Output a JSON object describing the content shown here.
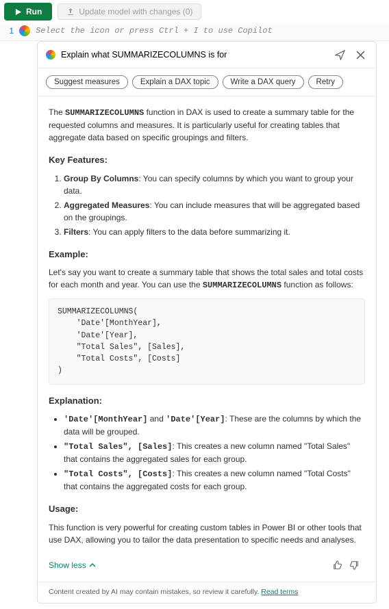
{
  "toolbar": {
    "run_label": "Run",
    "update_label": "Update model with changes (0)"
  },
  "editor": {
    "line": "1",
    "placeholder": "Select the icon or press Ctrl + I to use Copilot"
  },
  "panel": {
    "input_value": "Explain what SUMMARIZECOLUMNS is for",
    "chips": [
      "Suggest measures",
      "Explain a DAX topic",
      "Write a DAX query",
      "Retry"
    ]
  },
  "response": {
    "intro_pre": "The ",
    "intro_fn": "SUMMARIZECOLUMNS",
    "intro_post": " function in DAX is used to create a summary table for the requested columns and measures. It is particularly useful for creating tables that aggregate data based on specific groupings and filters.",
    "features_heading": "Key Features:",
    "features": [
      {
        "b": "Group By Columns",
        "t": ": You can specify columns by which you want to group your data."
      },
      {
        "b": "Aggregated Measures",
        "t": ": You can include measures that will be aggregated based on the groupings."
      },
      {
        "b": "Filters",
        "t": ": You can apply filters to the data before summarizing it."
      }
    ],
    "example_heading": "Example:",
    "example_intro_pre": "Let's say you want to create a summary table that shows the total sales and total costs for each month and year. You can use the ",
    "example_intro_fn": "SUMMARIZECOLUMNS",
    "example_intro_post": " function as follows:",
    "code": "SUMMARIZECOLUMNS(\n    'Date'[MonthYear],\n    'Date'[Year],\n    \"Total Sales\", [Sales],\n    \"Total Costs\", [Costs]\n)",
    "explanation_heading": "Explanation:",
    "explanation": [
      {
        "c": "'Date'[MonthYear]",
        "mid": " and ",
        "c2": "'Date'[Year]",
        "t": ": These are the columns by which the data will be grouped."
      },
      {
        "c": "\"Total Sales\", [Sales]",
        "t": ": This creates a new column named \"Total Sales\" that contains the aggregated sales for each group."
      },
      {
        "c": "\"Total Costs\", [Costs]",
        "t": ": This creates a new column named \"Total Costs\" that contains the aggregated costs for each group."
      }
    ],
    "usage_heading": "Usage:",
    "usage_text": "This function is very powerful for creating custom tables in Power BI or other tools that use DAX, allowing you to tailor the data presentation to specific needs and analyses.",
    "show_less": "Show less"
  },
  "disclaimer": {
    "text": "Content created by AI may contain mistakes, so review it carefully. ",
    "link": "Read terms"
  }
}
